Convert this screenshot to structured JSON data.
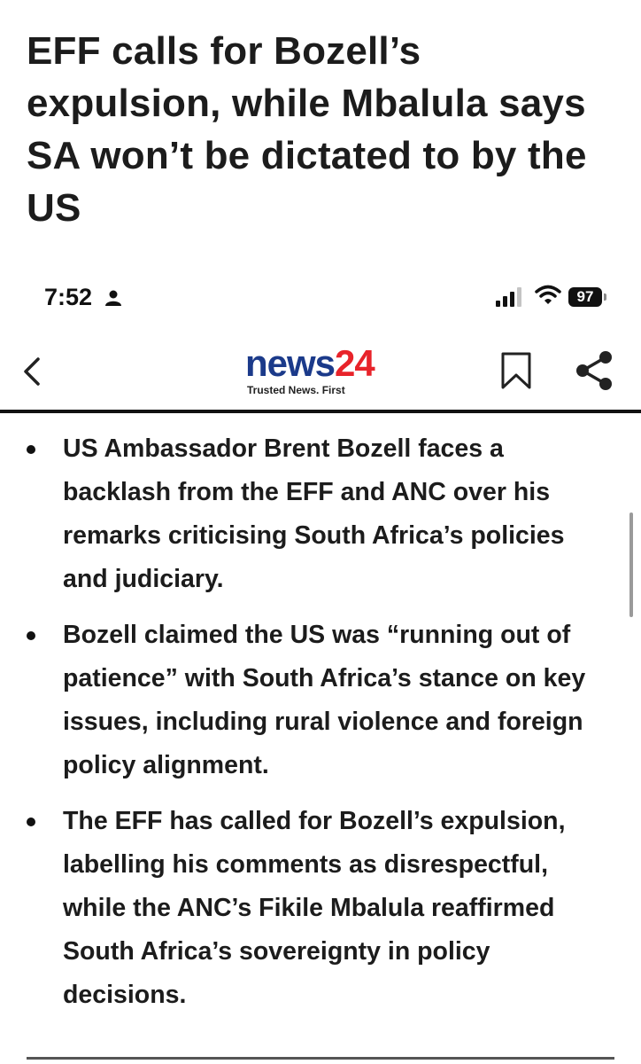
{
  "headline": "EFF calls for Bozell’s expulsion, while Mbalula says SA won’t be dictated to by the US",
  "status_bar": {
    "time": "7:52",
    "battery": "97",
    "icons": [
      "person-icon",
      "signal-icon",
      "wifi-icon",
      "battery-icon"
    ]
  },
  "nav": {
    "icons": [
      "back-icon",
      "bookmark-icon",
      "share-icon"
    ],
    "logo": {
      "text_primary": "news",
      "text_accent": "24",
      "tagline": "Trusted News. First",
      "primary_color": "#1b3a8a",
      "accent_color": "#e8232a"
    }
  },
  "summary_points": [
    "US Ambassador Brent Bozell faces a backlash from the EFF and ANC over his remarks criticising South Africa’s policies and judiciary.",
    "Bozell claimed the US was “running out of patience” with South Africa’s stance on key issues, including rural violence and foreign policy alignment.",
    "The EFF has called for Bozell’s expulsion, labelling his comments as disrespectful, while the ANC’s Fikile Mbalula reaffirmed South Africa’s sovereignty in policy decisions."
  ]
}
